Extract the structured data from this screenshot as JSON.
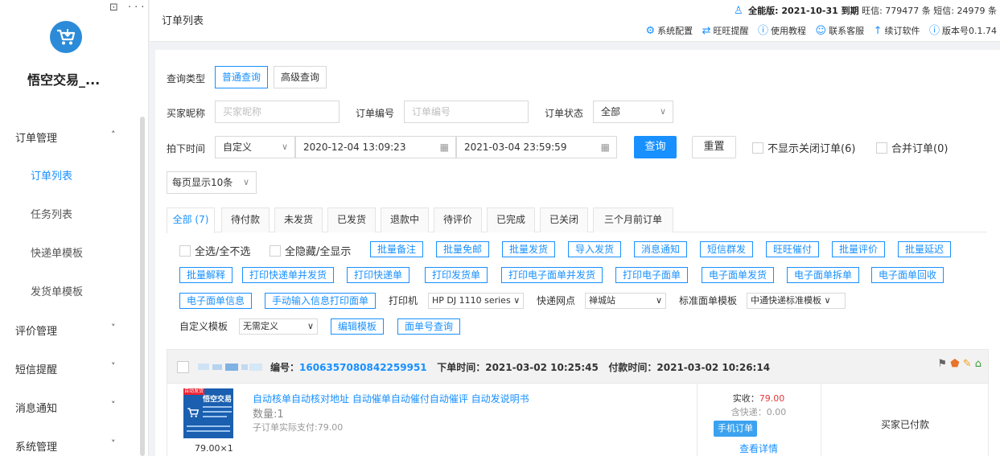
{
  "sidebar": {
    "tools": "⊡ ···",
    "app_name": "悟空交易_...",
    "menu": [
      {
        "label": "订单管理",
        "arrow": "˄"
      },
      {
        "label": "评价管理",
        "arrow": "˅"
      },
      {
        "label": "短信提醒",
        "arrow": "˅"
      },
      {
        "label": "消息通知",
        "arrow": "˅"
      },
      {
        "label": "系统管理",
        "arrow": "˅"
      }
    ],
    "submenu": [
      "订单列表",
      "任务列表",
      "快递单模板",
      "发货单模板"
    ]
  },
  "header": {
    "title": "订单列表",
    "edition": "全能版: 2021-10-31 到期",
    "wangxin": "旺信: 779477 条",
    "sms": "短信: 24979 条",
    "links": [
      "系统配置",
      "旺旺提醒",
      "使用教程",
      "联系客服",
      "续订软件",
      "版本号0.1.74"
    ]
  },
  "query": {
    "type_label": "查询类型",
    "normal": "普通查询",
    "advanced": "高级查询",
    "buyer_label": "买家昵称",
    "buyer_placeholder": "买家昵称",
    "order_no_label": "订单编号",
    "order_no_placeholder": "订单编号",
    "status_label": "订单状态",
    "status_value": "全部",
    "time_label": "拍下时间",
    "time_mode": "自定义",
    "start_time": "2020-12-04 13:09:23",
    "end_time": "2021-03-04 23:59:59",
    "search_btn": "查询",
    "reset_btn": "重置",
    "hide_closed": "不显示关闭订单(6)",
    "merge_orders": "合并订单(0)",
    "page_size": "每页显示10条"
  },
  "order_tabs": [
    "全部 (7)",
    "待付款",
    "未发货",
    "已发货",
    "退款中",
    "待评价",
    "已完成",
    "已关闭",
    "三个月前订单"
  ],
  "actions": {
    "select_all": "全选/全不选",
    "hide_all": "全隐藏/全显示",
    "row1": [
      "批量备注",
      "批量免邮",
      "批量发货",
      "导入发货",
      "消息通知",
      "短信群发",
      "旺旺催付",
      "批量评价",
      "批量延迟"
    ],
    "row2": [
      "批量解释",
      "打印快递单并发货",
      "打印快递单",
      "打印发货单",
      "打印电子面单并发货",
      "打印电子面单",
      "电子面单发货",
      "电子面单拆单",
      "电子面单回收"
    ],
    "row3": [
      "电子面单信息",
      "手动输入信息打印面单"
    ],
    "printer_label": "打印机",
    "printer_value": "HP DJ 1110 series",
    "express_label": "快递网点",
    "express_value": "禅城站",
    "template_label": "标准面单模板",
    "template_value": "中通快递标准模板",
    "custom_label": "自定义模板",
    "custom_value": "无需定义",
    "edit_template": "编辑模板",
    "query_waybill": "面单号查询"
  },
  "order": {
    "no_label": "编号：",
    "no": "1606357080842259951",
    "order_time": "下单时间：2021-03-02 10:25:45",
    "pay_time": "付款时间：2021-03-02 10:26:14",
    "product_title": "自动核单自动核对地址 自动催单自动催付自动催评 自动发说明书",
    "qty": "数量:1",
    "sub_paid": "子订单实际支付:79.00",
    "unit_price": "79.00×1",
    "paid_label": "实收：",
    "paid_value": "79.00",
    "shipping": "含快递：0.00",
    "mobile_btn": "手机订单",
    "detail_link": "查看详情",
    "status": "买家已付款",
    "img_brand": "悟空交易",
    "img_tag": "自动发货"
  }
}
